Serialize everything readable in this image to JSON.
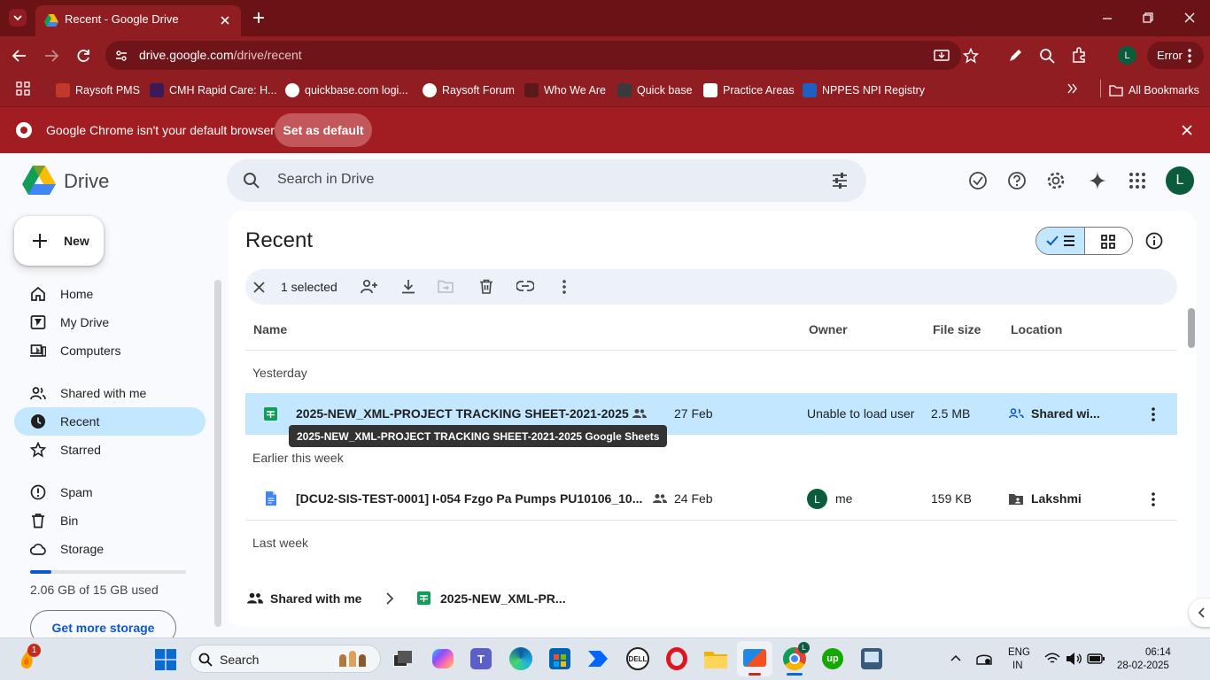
{
  "browser": {
    "tab_title": "Recent - Google Drive",
    "url_host": "drive.google.com",
    "url_path": "/drive/recent",
    "profile_initial": "L",
    "error_label": "Error",
    "bookmarks": [
      {
        "label": "Raysoft PMS",
        "color": "#c0392b"
      },
      {
        "label": "CMH Rapid Care: H...",
        "color": "#5b2c6f"
      },
      {
        "label": "quickbase.com logi...",
        "color": "#ffffff"
      },
      {
        "label": "Raysoft Forum",
        "color": "#ffffff"
      },
      {
        "label": "Who We Are",
        "color": "#5b1a1a"
      },
      {
        "label": "Quick base",
        "color": "#3a3a3a"
      },
      {
        "label": "Practice Areas",
        "color": "#ffffff"
      },
      {
        "label": "NPPES NPI Registry",
        "color": "#1f5fbf"
      }
    ],
    "all_bookmarks": "All Bookmarks",
    "infobar_text": "Google Chrome isn't your default browser",
    "set_default": "Set as default"
  },
  "drive": {
    "logo_text": "Drive",
    "search_placeholder": "Search in Drive",
    "avatar_initial": "L",
    "new_label": "New",
    "nav": [
      {
        "label": "Home"
      },
      {
        "label": "My Drive"
      },
      {
        "label": "Computers"
      },
      {
        "label": "Shared with me"
      },
      {
        "label": "Recent"
      },
      {
        "label": "Starred"
      },
      {
        "label": "Spam"
      },
      {
        "label": "Bin"
      },
      {
        "label": "Storage"
      }
    ],
    "storage_text": "2.06 GB of 15 GB used",
    "storage_fraction": 0.137,
    "get_storage": "Get more storage",
    "page_title": "Recent",
    "selected_text": "1 selected",
    "columns": {
      "name": "Name",
      "owner": "Owner",
      "size": "File size",
      "location": "Location"
    },
    "sections": {
      "yesterday": "Yesterday",
      "earlier": "Earlier this week",
      "last_week": "Last week"
    },
    "files": [
      {
        "name": "2025-NEW_XML-PROJECT TRACKING SHEET-2021-2025",
        "date": "27 Feb",
        "owner": "Unable to load user",
        "size": "2.5 MB",
        "location": "Shared wi..."
      },
      {
        "name": "[DCU2-SIS-TEST-0001] I-054 Fzgo Pa Pumps PU10106_10...",
        "date": "24 Feb",
        "owner_initial": "L",
        "owner": "me",
        "size": "159 KB",
        "location": "Lakshmi"
      }
    ],
    "tooltip": "2025-NEW_XML-PROJECT TRACKING SHEET-2021-2025 Google Sheets",
    "breadcrumb": {
      "root": "Shared with me",
      "file": "2025-NEW_XML-PR..."
    }
  },
  "taskbar": {
    "search_label": "Search",
    "notification_count": "1",
    "lang_line1": "ENG",
    "lang_line2": "IN",
    "time": "06:14",
    "date": "28-02-2025"
  }
}
